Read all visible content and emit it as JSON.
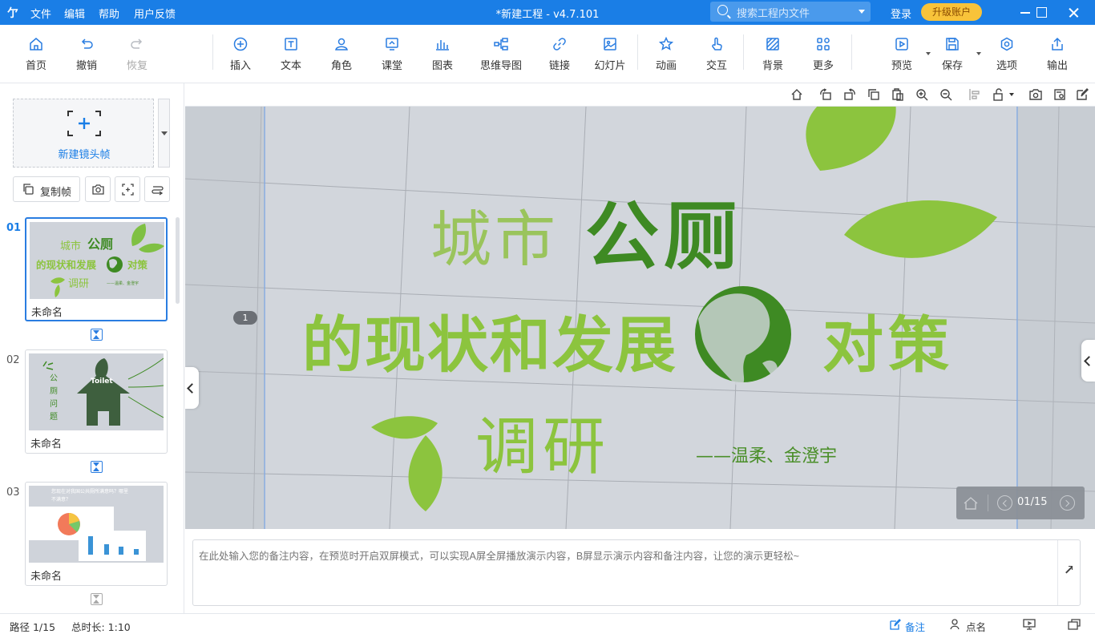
{
  "titlebar": {
    "logo": "亇",
    "menus": [
      "文件",
      "编辑",
      "帮助",
      "用户反馈"
    ],
    "title": "*新建工程 - v4.7.101",
    "search_placeholder": "搜索工程内文件",
    "login": "登录",
    "upgrade": "升级账户"
  },
  "toolbar": {
    "items": [
      {
        "label": "首页",
        "icon": "home-icon"
      },
      {
        "label": "撤销",
        "icon": "undo-icon"
      },
      {
        "label": "恢复",
        "icon": "redo-icon",
        "disabled": true
      },
      {
        "label": "插入",
        "icon": "plus-circle-icon"
      },
      {
        "label": "文本",
        "icon": "text-icon"
      },
      {
        "label": "角色",
        "icon": "person-icon"
      },
      {
        "label": "课堂",
        "icon": "classroom-icon"
      },
      {
        "label": "图表",
        "icon": "bar-chart-icon"
      },
      {
        "label": "思维导图",
        "icon": "mindmap-icon"
      },
      {
        "label": "链接",
        "icon": "link-icon"
      },
      {
        "label": "幻灯片",
        "icon": "slide-icon"
      },
      {
        "label": "动画",
        "icon": "star-icon"
      },
      {
        "label": "交互",
        "icon": "hand-icon"
      },
      {
        "label": "背景",
        "icon": "background-icon"
      },
      {
        "label": "更多",
        "icon": "grid-icon"
      },
      {
        "label": "预览",
        "icon": "play-icon"
      },
      {
        "label": "保存",
        "icon": "save-icon"
      },
      {
        "label": "选项",
        "icon": "options-icon"
      },
      {
        "label": "输出",
        "icon": "export-icon"
      }
    ]
  },
  "sidebar": {
    "new_frame_label": "新建镜头帧",
    "copy_frame_label": "复制帧",
    "frames": [
      {
        "num": "01",
        "name": "未命名",
        "active": true,
        "preview": {
          "line1a": "城市",
          "line1b": "公厕",
          "line2a": "的现状和发展",
          "line2b": "对策",
          "line3": "调研",
          "author": "——温柔、金澄宇"
        }
      },
      {
        "num": "02",
        "name": "未命名",
        "active": false,
        "preview": {
          "vertical_text": [
            "公",
            "厕",
            "问",
            "题"
          ],
          "sign": "Toilet"
        }
      },
      {
        "num": "03",
        "name": "未命名",
        "active": false,
        "preview": {
          "question": "您现在对我国公共厕所满意吗？哪里不满意？"
        }
      }
    ]
  },
  "canvas": {
    "title_line1_light": "城市",
    "title_line1_bold": "公厕",
    "title_line2_left": "的现状和发展",
    "title_line2_right": "对策",
    "title_line3": "调研",
    "author": "——温柔、金澄宇",
    "path_badge": "1",
    "page_counter": "01/15"
  },
  "notes": {
    "placeholder": "在此处输入您的备注内容，在预览时开启双屏模式，可以实现A屏全屏播放演示内容，B屏显示演示内容和备注内容，让您的演示更轻松~"
  },
  "statusbar": {
    "path": "路径 1/15",
    "duration": "总时长: 1:10",
    "notes_btn": "备注",
    "rollcall_btn": "点名"
  },
  "colors": {
    "accent": "#1a7ee6",
    "leaf_light": "#8cc43e",
    "leaf_dark": "#3e8a23",
    "upgrade": "#f8c33a"
  }
}
